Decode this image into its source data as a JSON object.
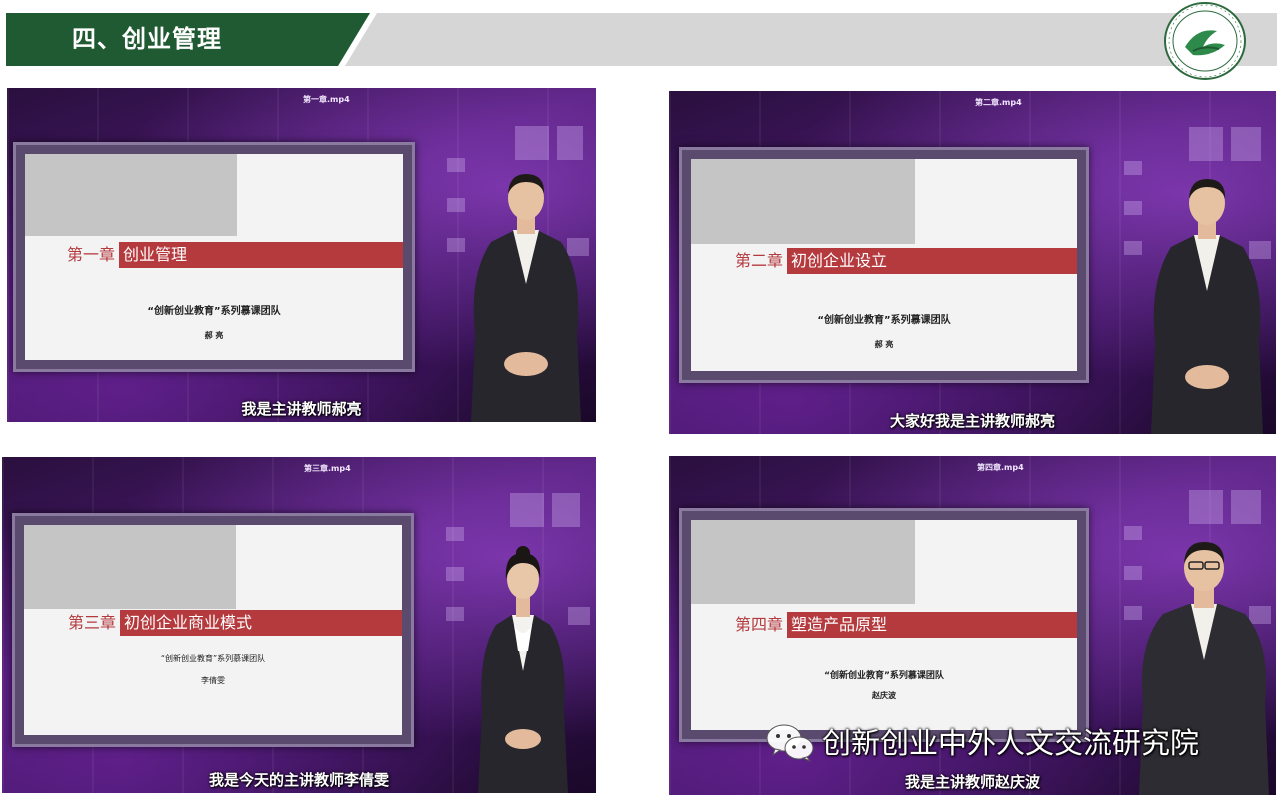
{
  "header": {
    "title": "四、创业管理",
    "green_color": "#1f5a32",
    "gray_color": "#d6d6d6",
    "logo_icon": "university-seal-icon"
  },
  "tiles": [
    {
      "file": "第一章.mp4",
      "chapter": "第一章",
      "chapter_title": "创业管理",
      "team": "“创新创业教育”系列慕课团队",
      "author": "郝 亮",
      "subtitle": "我是主讲教师郝亮"
    },
    {
      "file": "第二章.mp4",
      "chapter": "第二章",
      "chapter_title": "初创企业设立",
      "team": "“创新创业教育”系列慕课团队",
      "author": "郝 亮",
      "subtitle": "大家好我是主讲教师郝亮"
    },
    {
      "file": "第三章.mp4",
      "chapter": "第三章",
      "chapter_title": "初创企业商业模式",
      "team": "“创新创业教育”系列慕课团队",
      "author": "李倩雯",
      "subtitle": "我是今天的主讲教师李倩雯"
    },
    {
      "file": "第四章.mp4",
      "chapter": "第四章",
      "chapter_title": "塑造产品原型",
      "team": "“创新创业教育”系列慕课团队",
      "author": "赵庆波",
      "subtitle": "我是主讲教师赵庆波"
    }
  ],
  "watermark": {
    "icon": "wechat-icon",
    "text": "创新创业中外人文交流研究院"
  },
  "colors": {
    "slide_band": "#b43a3e",
    "tile_purple": "#4a1a6e"
  }
}
